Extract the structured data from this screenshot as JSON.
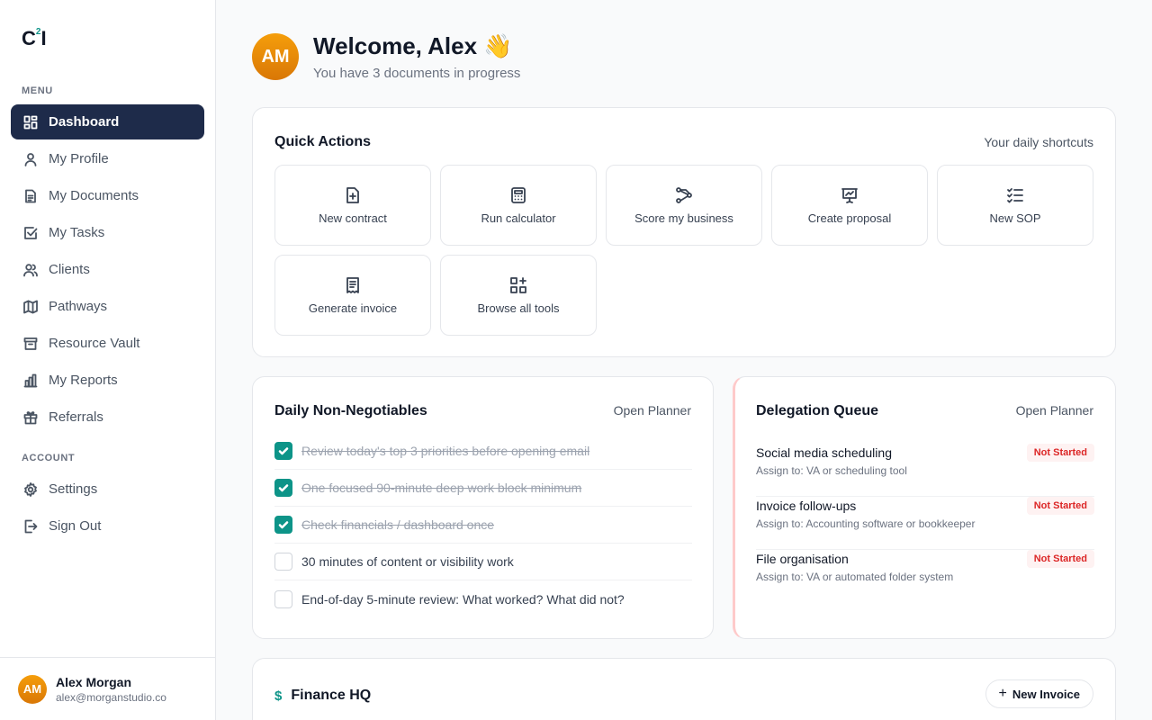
{
  "brand": {
    "logo_main": "C",
    "logo_sup": "2",
    "logo_end": "I",
    "accent": "#0d9488",
    "nav_active_bg": "#1e2b4a"
  },
  "sidebar": {
    "menu_label": "MENU",
    "account_label": "ACCOUNT",
    "menu_items": [
      {
        "label": "Dashboard",
        "icon": "dashboard-icon",
        "active": true
      },
      {
        "label": "My Profile",
        "icon": "user-icon"
      },
      {
        "label": "My Documents",
        "icon": "document-icon"
      },
      {
        "label": "My Tasks",
        "icon": "checkbox-icon"
      },
      {
        "label": "Clients",
        "icon": "users-icon"
      },
      {
        "label": "Pathways",
        "icon": "map-icon"
      },
      {
        "label": "Resource Vault",
        "icon": "archive-icon"
      },
      {
        "label": "My Reports",
        "icon": "bar-chart-icon"
      },
      {
        "label": "Referrals",
        "icon": "gift-icon"
      }
    ],
    "account_items": [
      {
        "label": "Settings",
        "icon": "gear-icon"
      },
      {
        "label": "Sign Out",
        "icon": "sign-out-icon"
      }
    ],
    "user": {
      "initials": "AM",
      "name": "Alex Morgan",
      "email": "alex@morganstudio.co"
    }
  },
  "header": {
    "initials": "AM",
    "title": "Welcome, Alex 👋",
    "subtitle": "You have 3 documents in progress"
  },
  "quick_actions": {
    "title": "Quick Actions",
    "subtitle": "Your daily shortcuts",
    "items": [
      {
        "label": "New contract",
        "icon": "file-plus-icon"
      },
      {
        "label": "Run calculator",
        "icon": "calculator-icon"
      },
      {
        "label": "Score my business",
        "icon": "route-icon"
      },
      {
        "label": "Create proposal",
        "icon": "presentation-icon"
      },
      {
        "label": "New SOP",
        "icon": "checklist-icon"
      },
      {
        "label": "Generate invoice",
        "icon": "receipt-icon"
      },
      {
        "label": "Browse all tools",
        "icon": "grid-plus-icon"
      }
    ]
  },
  "non_negotiables": {
    "title": "Daily Non-Negotiables",
    "link": "Open Planner",
    "items": [
      {
        "label": "Review today's top 3 priorities before opening email",
        "done": true
      },
      {
        "label": "One focused 90-minute deep work block minimum",
        "done": true
      },
      {
        "label": "Check financials / dashboard once",
        "done": true
      },
      {
        "label": "30 minutes of content or visibility work",
        "done": false
      },
      {
        "label": "End-of-day 5-minute review: What worked? What did not?",
        "done": false
      }
    ]
  },
  "delegation": {
    "title": "Delegation Queue",
    "link": "Open Planner",
    "items": [
      {
        "name": "Social media scheduling",
        "assign": "Assign to: VA or scheduling tool",
        "status": "Not Started"
      },
      {
        "name": "Invoice follow-ups",
        "assign": "Assign to: Accounting software or bookkeeper",
        "status": "Not Started"
      },
      {
        "name": "File organisation",
        "assign": "Assign to: VA or automated folder system",
        "status": "Not Started"
      }
    ]
  },
  "finance": {
    "title": "Finance HQ",
    "icon": "dollar-icon",
    "button": "New Invoice"
  }
}
